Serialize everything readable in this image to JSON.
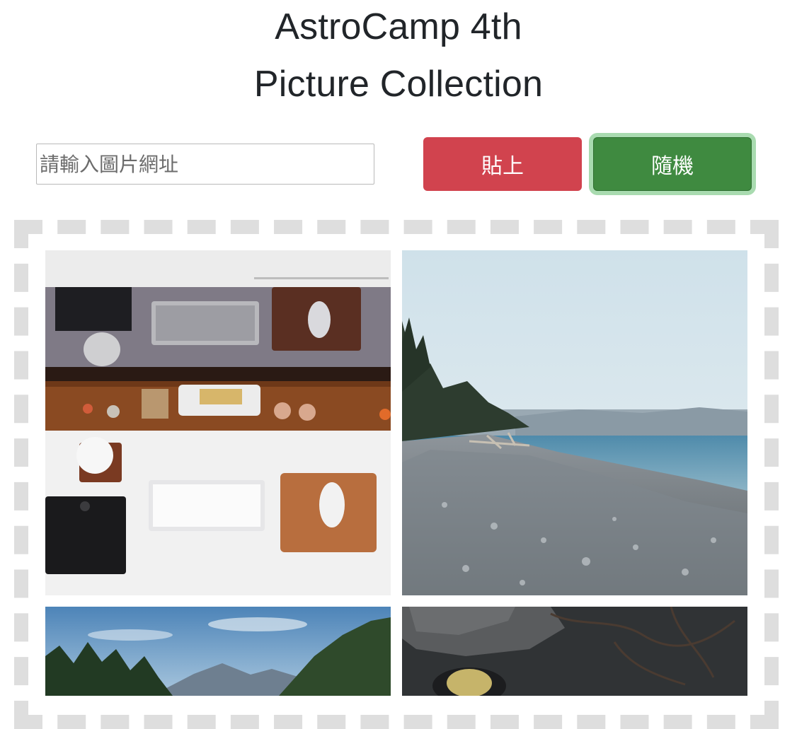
{
  "header": {
    "title_line1": "AstroCamp 4th",
    "title_line2": "Picture Collection"
  },
  "controls": {
    "url_input": {
      "placeholder": "請輸入圖片網址",
      "value": ""
    },
    "paste_button_label": "貼上",
    "random_button_label": "隨機"
  },
  "colors": {
    "paste_button": "#d1434e",
    "random_button": "#3f8a40",
    "random_button_focus_ring": "#a9dbb0",
    "dropzone_border": "#dedede"
  },
  "gallery": {
    "photos": [
      {
        "subject": "desk workspace with keyboards and mice, top-down view"
      },
      {
        "subject": "pebble beach with sea and forested shore"
      },
      {
        "subject": "mountains and forest under blue sky"
      },
      {
        "subject": "dark wooden table with cloth, bowl and branches"
      }
    ]
  }
}
